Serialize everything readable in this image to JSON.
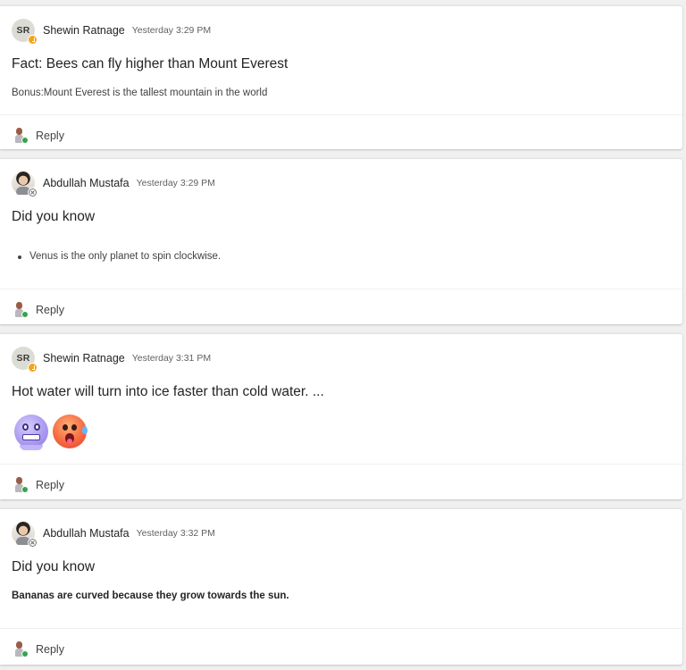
{
  "posts": [
    {
      "author": "Shewin Ratnage",
      "avatar_initials": "SR",
      "avatar_kind": "initials",
      "presence": "away",
      "timestamp": "Yesterday 3:29 PM",
      "subject": "Fact: Bees can fly higher than Mount Everest",
      "body_text": "Bonus:Mount Everest is the tallest mountain in the world",
      "reply_label": "Reply"
    },
    {
      "author": "Abdullah Mustafa",
      "avatar_kind": "photo",
      "presence": "offline",
      "timestamp": "Yesterday 3:29 PM",
      "subject": "Did you know",
      "body_bullet": "Venus is the only planet to spin clockwise.",
      "reply_label": "Reply"
    },
    {
      "author": "Shewin Ratnage",
      "avatar_initials": "SR",
      "avatar_kind": "initials",
      "presence": "away",
      "timestamp": "Yesterday 3:31 PM",
      "subject": "Hot water will turn into ice faster than cold water. ...",
      "emojis": [
        "cold-face-emoji",
        "hot-face-emoji"
      ],
      "reply_label": "Reply"
    },
    {
      "author": "Abdullah Mustafa",
      "avatar_kind": "photo",
      "presence": "offline",
      "timestamp": "Yesterday 3:32 PM",
      "subject": "Did you know",
      "body_bold": "Bananas are curved because they grow towards the sun.",
      "reply_label": "Reply"
    }
  ],
  "colors": {
    "page_background": "#f0f0f0",
    "card_background": "#ffffff",
    "presence_away": "#f3a51b",
    "presence_available": "#36a54a"
  }
}
